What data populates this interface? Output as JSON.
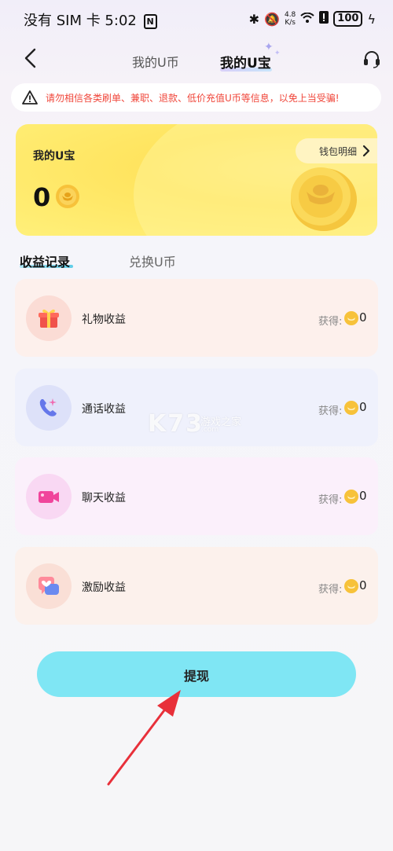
{
  "status_bar": {
    "carrier_time": "没有 SIM 卡 5:02",
    "nfc": "N",
    "net_speed_value": "4.8",
    "net_speed_unit": "K/s",
    "battery": "100"
  },
  "nav": {
    "tab_coins": "我的U币",
    "tab_treasure": "我的U宝"
  },
  "warning": {
    "text": "请勿相信各类刷单、兼职、退款、低价充值U币等信息，以免上当受骗!"
  },
  "card": {
    "label": "我的U宝",
    "amount": "0",
    "wallet_button": "钱包明细"
  },
  "records": {
    "tab_income": "收益记录",
    "tab_exchange": "兑换U币",
    "items": [
      {
        "label": "礼物收益",
        "earn_label": "获得:",
        "value": "0"
      },
      {
        "label": "通话收益",
        "earn_label": "获得:",
        "value": "0"
      },
      {
        "label": "聊天收益",
        "earn_label": "获得:",
        "value": "0"
      },
      {
        "label": "激励收益",
        "earn_label": "获得:",
        "value": "0"
      }
    ]
  },
  "watermark": {
    "logo": "K73",
    "sub": "游戏之家",
    "url": ".com"
  },
  "withdraw_button": "提现",
  "colors": {
    "accent": "#7fe6f4",
    "warning": "#f0463a",
    "card": "#ffe45f"
  }
}
